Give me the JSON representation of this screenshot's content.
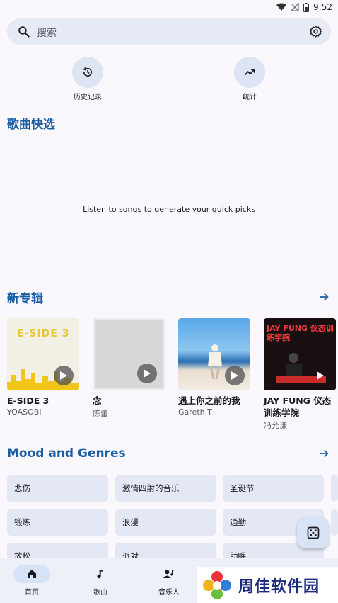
{
  "status_bar": {
    "time": "9:52"
  },
  "search": {
    "placeholder": "搜索"
  },
  "quick_actions": [
    {
      "label": "历史记录",
      "icon": "history-icon"
    },
    {
      "label": "统计",
      "icon": "trending-up-icon"
    }
  ],
  "quick_picks": {
    "title": "歌曲快选",
    "empty_message": "Listen to songs to generate your quick picks"
  },
  "new_albums": {
    "title": "新专辑",
    "items": [
      {
        "title": "E-SIDE 3",
        "artist": "YOASOBI",
        "cover_text": "E-SIDE 3"
      },
      {
        "title": "念",
        "artist": "陈蕾"
      },
      {
        "title": "遇上你之前的我",
        "artist": "Gareth.T"
      },
      {
        "title": "JAY FUNG 仪态训练学院",
        "artist": "冯允谦",
        "cover_text": "JAY FUNG 仪态训练学院"
      }
    ]
  },
  "moods": {
    "title": "Mood and Genres",
    "items": [
      "悲伤",
      "激情四射的音乐",
      "圣诞节",
      "锻炼",
      "浪漫",
      "通勤",
      "放松",
      "派对",
      "助眠"
    ]
  },
  "bottom_nav": {
    "items": [
      {
        "label": "首页",
        "icon": "home-icon",
        "active": true
      },
      {
        "label": "歌曲",
        "icon": "music-note-icon",
        "active": false
      },
      {
        "label": "音乐人",
        "icon": "artist-icon",
        "active": false
      }
    ]
  },
  "watermark": {
    "text": "周佳软件园"
  },
  "colors": {
    "accent": "#1a5fa6",
    "background": "#fbf8fd",
    "chip": "#e3e8f4"
  }
}
